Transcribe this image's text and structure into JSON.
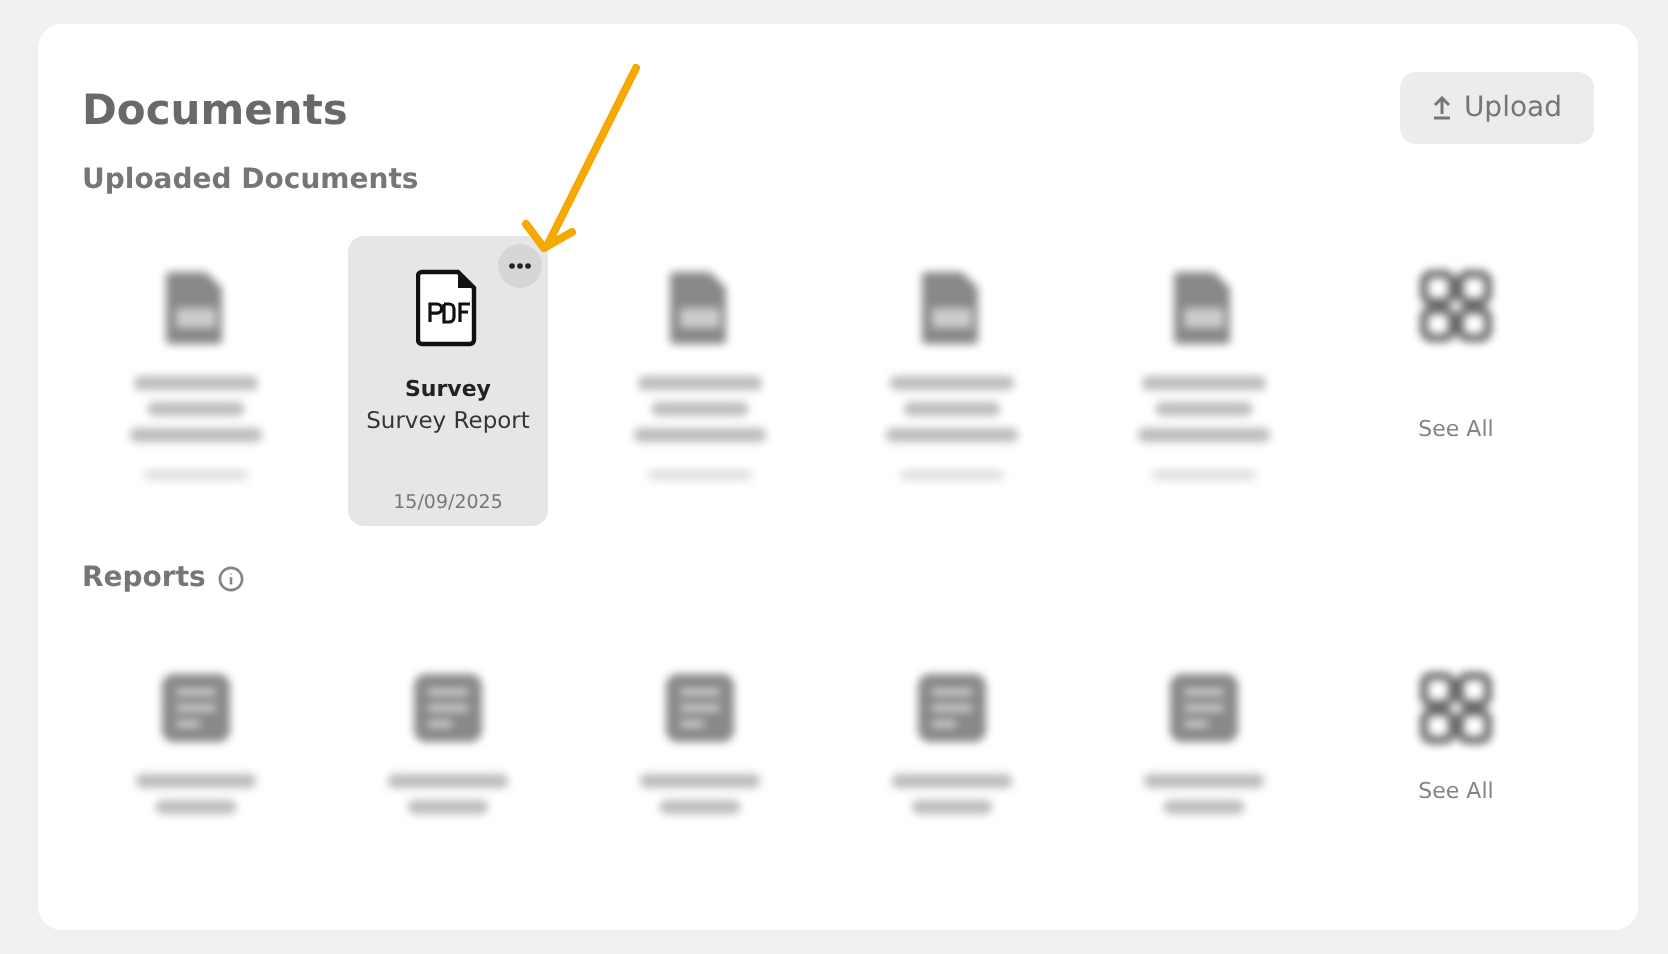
{
  "title": "Documents",
  "upload_button": {
    "label": "Upload"
  },
  "sections": [
    {
      "heading": "Uploaded Documents",
      "info": false,
      "items": [
        {
          "kind": "file",
          "selected": false
        },
        {
          "kind": "file",
          "selected": true,
          "title": "Survey",
          "subtitle": "Survey Report",
          "date": "15/09/2025"
        },
        {
          "kind": "file",
          "selected": false
        },
        {
          "kind": "file",
          "selected": false
        },
        {
          "kind": "file",
          "selected": false
        },
        {
          "kind": "see_all",
          "selected": false,
          "label": "See All"
        }
      ]
    },
    {
      "heading": "Reports",
      "info": true,
      "items": [
        {
          "kind": "report",
          "selected": false
        },
        {
          "kind": "report",
          "selected": false
        },
        {
          "kind": "report",
          "selected": false
        },
        {
          "kind": "report",
          "selected": false
        },
        {
          "kind": "report",
          "selected": false
        },
        {
          "kind": "see_all",
          "selected": false,
          "label": "See All"
        }
      ]
    }
  ]
}
